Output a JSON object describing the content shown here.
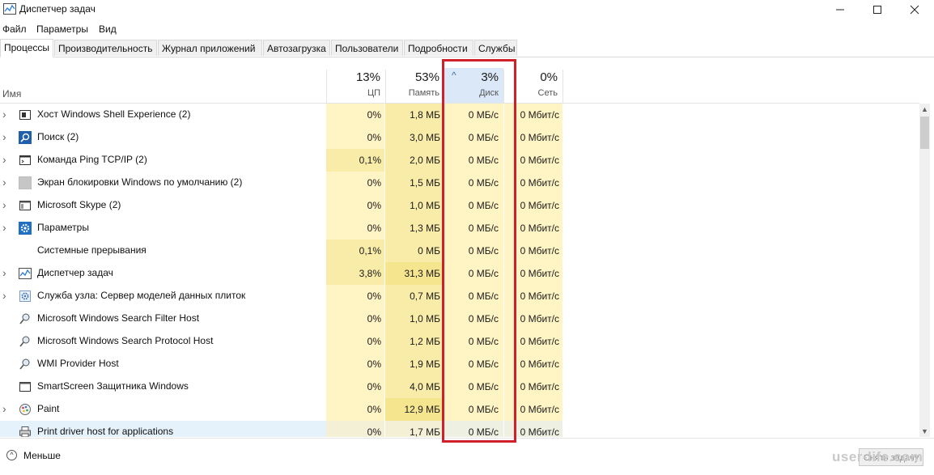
{
  "window": {
    "title": "Диспетчер задач",
    "min_icon": "minimize-icon",
    "max_icon": "maximize-icon",
    "close_icon": "close-icon"
  },
  "menu": [
    "Файл",
    "Параметры",
    "Вид"
  ],
  "tabs": [
    {
      "label": "Процессы",
      "active": true
    },
    {
      "label": "Производительность"
    },
    {
      "label": "Журнал приложений"
    },
    {
      "label": "Автозагрузка"
    },
    {
      "label": "Пользователи"
    },
    {
      "label": "Подробности"
    },
    {
      "label": "Службы"
    }
  ],
  "columns": {
    "name": "Имя",
    "cpu": {
      "pct": "13%",
      "label": "ЦП"
    },
    "memory": {
      "pct": "53%",
      "label": "Память"
    },
    "disk": {
      "pct": "3%",
      "label": "Диск",
      "sorted": "^"
    },
    "network": {
      "pct": "0%",
      "label": "Сеть"
    }
  },
  "processes": [
    {
      "name": "Хост Windows Shell Experience (2)",
      "cpu": "0%",
      "mem": "1,8 МБ",
      "disk": "0 МБ/с",
      "net": "0 Мбит/с",
      "expandable": true,
      "icon": "shell-window-icon"
    },
    {
      "name": "Поиск (2)",
      "cpu": "0%",
      "mem": "3,0 МБ",
      "disk": "0 МБ/с",
      "net": "0 Мбит/с",
      "expandable": true,
      "icon": "search-icon"
    },
    {
      "name": "Команда Ping TCP/IP (2)",
      "cpu": "0,1%",
      "mem": "2,0 МБ",
      "disk": "0 МБ/с",
      "net": "0 Мбит/с",
      "expandable": true,
      "icon": "console-icon"
    },
    {
      "name": "Экран блокировки Windows по умолчанию (2)",
      "cpu": "0%",
      "mem": "1,5 МБ",
      "disk": "0 МБ/с",
      "net": "0 Мбит/с",
      "expandable": true,
      "icon": "lock-screen-icon"
    },
    {
      "name": "Microsoft Skype (2)",
      "cpu": "0%",
      "mem": "1,0 МБ",
      "disk": "0 МБ/с",
      "net": "0 Мбит/с",
      "expandable": true,
      "icon": "app-window-icon"
    },
    {
      "name": "Параметры",
      "cpu": "0%",
      "mem": "1,3 МБ",
      "disk": "0 МБ/с",
      "net": "0 Мбит/с",
      "expandable": true,
      "icon": "gear-icon"
    },
    {
      "name": "Системные прерывания",
      "cpu": "0,1%",
      "mem": "0 МБ",
      "disk": "0 МБ/с",
      "net": "0 Мбит/с",
      "expandable": false,
      "icon": "blank-icon"
    },
    {
      "name": "Диспетчер задач",
      "cpu": "3,8%",
      "mem": "31,3 МБ",
      "disk": "0 МБ/с",
      "net": "0 Мбит/с",
      "expandable": true,
      "icon": "task-manager-icon"
    },
    {
      "name": "Служба узла: Сервер моделей данных плиток",
      "cpu": "0%",
      "mem": "0,7 МБ",
      "disk": "0 МБ/с",
      "net": "0 Мбит/с",
      "expandable": true,
      "icon": "service-gear-icon"
    },
    {
      "name": "Microsoft Windows Search Filter Host",
      "cpu": "0%",
      "mem": "1,0 МБ",
      "disk": "0 МБ/с",
      "net": "0 Мбит/с",
      "expandable": false,
      "icon": "search-host-icon"
    },
    {
      "name": "Microsoft Windows Search Protocol Host",
      "cpu": "0%",
      "mem": "1,2 МБ",
      "disk": "0 МБ/с",
      "net": "0 Мбит/с",
      "expandable": false,
      "icon": "search-host-icon"
    },
    {
      "name": "WMI Provider Host",
      "cpu": "0%",
      "mem": "1,9 МБ",
      "disk": "0 МБ/с",
      "net": "0 Мбит/с",
      "expandable": false,
      "icon": "wmi-icon"
    },
    {
      "name": "SmartScreen Защитника Windows",
      "cpu": "0%",
      "mem": "4,0 МБ",
      "disk": "0 МБ/с",
      "net": "0 Мбит/с",
      "expandable": false,
      "icon": "smartscreen-icon"
    },
    {
      "name": "Paint",
      "cpu": "0%",
      "mem": "12,9 МБ",
      "disk": "0 МБ/с",
      "net": "0 Мбит/с",
      "expandable": true,
      "icon": "paint-icon"
    },
    {
      "name": "Print driver host for applications",
      "cpu": "0%",
      "mem": "1,7 МБ",
      "disk": "0 МБ/с",
      "net": "0 Мбит/с",
      "expandable": false,
      "icon": "printer-icon",
      "selected": true
    }
  ],
  "footer": {
    "less_label": "Меньше",
    "end_task_label": "Снять задачу"
  },
  "watermark": "user-life.com",
  "colors": {
    "highlight": "#d0202b",
    "heat_low": "#fff4c4",
    "heat_mid": "#f9eca8",
    "disk_header": "#dbe8f7"
  }
}
